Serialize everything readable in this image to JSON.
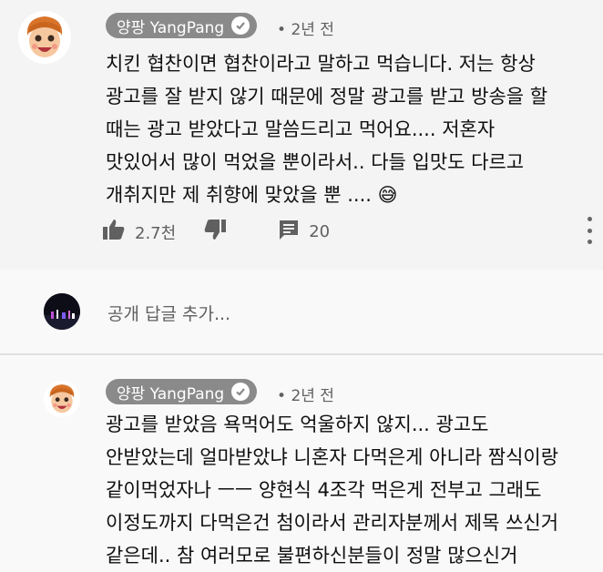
{
  "comment1": {
    "author": "양팡 YangPang",
    "time": "2년 전",
    "lines": [
      "치킨 협찬이면 협찬이라고 말하고 먹습니다. 저는 항상",
      "광고를 잘 받지 않기 때문에 정말 광고를 받고 방송을 할",
      "때는 광고 받았다고 말씀드리고 먹어요.... 저혼자",
      "맛있어서 많이 먹었을 뿐이라서.. 다들 입맛도 다르고",
      "개취지만 제 취향에 맞았을 뿐 ...."
    ],
    "emoji": "😅",
    "likes": "2.7천",
    "replies": "20"
  },
  "reply_box": {
    "placeholder": "공개 답글 추가..."
  },
  "comment2": {
    "author": "양팡 YangPang",
    "time": "2년 전",
    "lines": [
      "광고를 받았음 욕먹어도 억울하지 않지... 광고도",
      "안받았는데 얼마받았냐 니혼자 다먹은게 아니라 짬식이랑",
      "같이먹었자나 ㅡㅡ 양현식 4조각 먹은게 전부고 그래도",
      "이정도까지 다먹은건 첨이라서 관리자분께서 제목 쓰신거",
      "같은데.. 참 여러모로 불편하신분들이 정말 많으신거"
    ]
  },
  "colors": {
    "chip": "#8a8a8a",
    "muted": "#606060",
    "bg_top": "#f4f4f4",
    "bg": "#f9f9f9"
  }
}
